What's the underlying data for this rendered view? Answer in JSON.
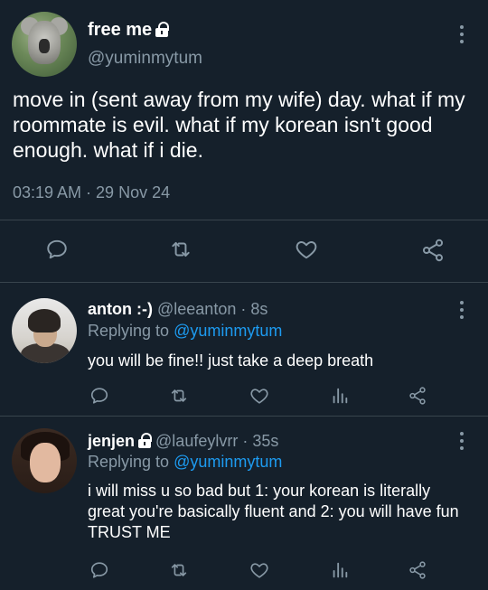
{
  "main_tweet": {
    "display_name": "free me",
    "handle": "@yuminmytum",
    "text": "move in (sent away from my wife) day. what if my roommate is evil. what if my korean isn't good enough. what if i die.",
    "timestamp": "03:19 AM · 29 Nov 24",
    "actions": [
      "reply-icon",
      "retweet-icon",
      "like-icon",
      "share-icon"
    ]
  },
  "replies": [
    {
      "display_name": "anton :-)",
      "handle": "@leeanton",
      "time": "· 8s",
      "replying_label": "Replying to",
      "replying_to": "@yuminmytum",
      "text": "you will be fine!! just take a deep breath",
      "actions": [
        "reply-icon",
        "retweet-icon",
        "like-icon",
        "stats-icon",
        "share-icon"
      ]
    },
    {
      "display_name": "jenjen",
      "handle": "@laufeylvrr",
      "time": "· 35s",
      "replying_label": "Replying to",
      "replying_to": "@yuminmytum",
      "text": "i will miss u so bad but 1: your korean is literally great you're basically fluent and 2: you will have fun TRUST ME",
      "actions": [
        "reply-icon",
        "retweet-icon",
        "like-icon",
        "stats-icon",
        "share-icon"
      ]
    }
  ],
  "colors": {
    "background": "#15202b",
    "text": "#ffffff",
    "muted": "#8899a6",
    "link": "#1d9bf0",
    "divider": "#38444d"
  }
}
